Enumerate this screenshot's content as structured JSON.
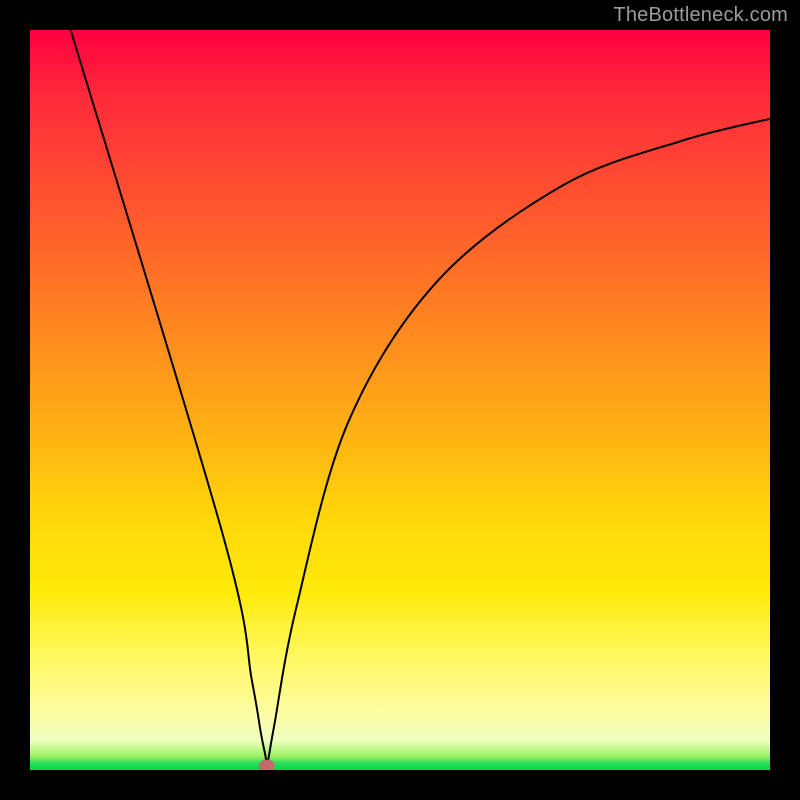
{
  "watermark": "TheBottleneck.com",
  "chart_data": {
    "type": "line",
    "title": "",
    "xlabel": "",
    "ylabel": "",
    "xlim": [
      0,
      100
    ],
    "ylim": [
      0,
      100
    ],
    "curve": {
      "description": "V-shaped bottleneck curve",
      "points": [
        {
          "x": 5.5,
          "y": 100
        },
        {
          "x": 26.0,
          "y": 32
        },
        {
          "x": 30.0,
          "y": 12
        },
        {
          "x": 31.2,
          "y": 5
        },
        {
          "x": 31.8,
          "y": 2
        },
        {
          "x": 32.0,
          "y": 0.8
        },
        {
          "x": 32.3,
          "y": 2
        },
        {
          "x": 33.0,
          "y": 6
        },
        {
          "x": 36.0,
          "y": 22
        },
        {
          "x": 43.0,
          "y": 47
        },
        {
          "x": 55.0,
          "y": 66
        },
        {
          "x": 72.0,
          "y": 79
        },
        {
          "x": 88.0,
          "y": 85
        },
        {
          "x": 100.0,
          "y": 88
        }
      ]
    },
    "marker": {
      "x": 32.0,
      "y": 0.6,
      "rx": 1.1,
      "ry": 0.8,
      "color": "#c46a6a"
    },
    "background_gradient": {
      "type": "vertical",
      "stops": [
        {
          "pos": 0,
          "color": "#ff0040"
        },
        {
          "pos": 54,
          "color": "#ffb014"
        },
        {
          "pos": 84,
          "color": "#fff85a"
        },
        {
          "pos": 99,
          "color": "#30e060"
        },
        {
          "pos": 100,
          "color": "#00d840"
        }
      ]
    }
  }
}
